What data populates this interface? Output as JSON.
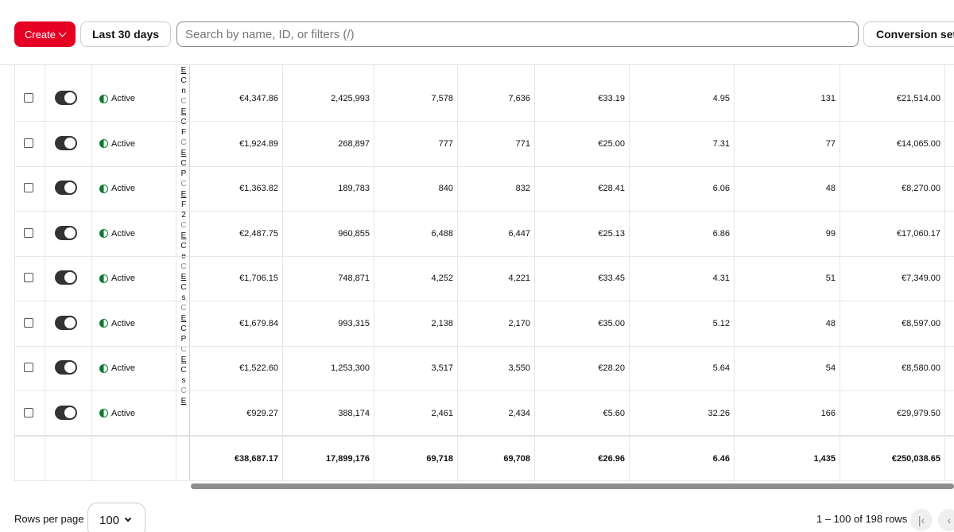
{
  "toolbar": {
    "create_label": "Create",
    "date_label": "Last 30 days",
    "search_placeholder": "Search by name, ID, or filters (/)",
    "conversion_label": "Conversion set"
  },
  "colors": {
    "accent": "#e60023",
    "active_status": "#0a7a2f",
    "toggle_on": "#333333"
  },
  "rows": [
    {
      "status": "Active",
      "spend": "€4,347.86",
      "impressions": "2,425,993",
      "c1": "7,578",
      "c2": "7,636",
      "cpa": "€33.19",
      "roas": "4.95",
      "conversions": "131",
      "value": "€21,514.00",
      "toggle": true,
      "checked": false
    },
    {
      "status": "Active",
      "spend": "€1,924.89",
      "impressions": "268,897",
      "c1": "777",
      "c2": "771",
      "cpa": "€25.00",
      "roas": "7.31",
      "conversions": "77",
      "value": "€14,065.00",
      "toggle": true,
      "checked": false
    },
    {
      "status": "Active",
      "spend": "€1,363.82",
      "impressions": "189,783",
      "c1": "840",
      "c2": "832",
      "cpa": "€28.41",
      "roas": "6.06",
      "conversions": "48",
      "value": "€8,270.00",
      "toggle": true,
      "checked": false
    },
    {
      "status": "Active",
      "spend": "€2,487.75",
      "impressions": "960,855",
      "c1": "6,488",
      "c2": "6,447",
      "cpa": "€25.13",
      "roas": "6.86",
      "conversions": "99",
      "value": "€17,060.17",
      "toggle": true,
      "checked": false
    },
    {
      "status": "Active",
      "spend": "€1,706.15",
      "impressions": "748,871",
      "c1": "4,252",
      "c2": "4,221",
      "cpa": "€33.45",
      "roas": "4.31",
      "conversions": "51",
      "value": "€7,349.00",
      "toggle": true,
      "checked": false
    },
    {
      "status": "Active",
      "spend": "€1,679.84",
      "impressions": "993,315",
      "c1": "2,138",
      "c2": "2,170",
      "cpa": "€35.00",
      "roas": "5.12",
      "conversions": "48",
      "value": "€8,597.00",
      "toggle": true,
      "checked": false
    },
    {
      "status": "Active",
      "spend": "€1,522.60",
      "impressions": "1,253,300",
      "c1": "3,517",
      "c2": "3,550",
      "cpa": "€28.20",
      "roas": "5.64",
      "conversions": "54",
      "value": "€8,580.00",
      "toggle": true,
      "checked": false
    },
    {
      "status": "Active",
      "spend": "€929.27",
      "impressions": "388,174",
      "c1": "2,461",
      "c2": "2,434",
      "cpa": "€5.60",
      "roas": "32.26",
      "conversions": "166",
      "value": "€29,979.50",
      "toggle": true,
      "checked": false
    }
  ],
  "name_column_glyphs": [
    [
      "E",
      "C",
      "n",
      "C"
    ],
    [
      "E",
      "C",
      "F",
      "C"
    ],
    [
      "E",
      "C",
      "P",
      "C"
    ],
    [
      "E",
      "F",
      "2",
      "C"
    ],
    [
      "E",
      "C",
      "e",
      "C"
    ],
    [
      "E",
      "C",
      "s",
      "C"
    ],
    [
      "E",
      "C",
      "P",
      "C"
    ],
    [
      "E",
      "C",
      "s",
      "C"
    ],
    [
      "E"
    ]
  ],
  "totals": {
    "spend": "€38,687.17",
    "impressions": "17,899,176",
    "c1": "69,718",
    "c2": "69,708",
    "cpa": "€26.96",
    "roas": "6.46",
    "conversions": "1,435",
    "value": "€250,038.65"
  },
  "footer": {
    "rows_per_page_label": "Rows per page",
    "rows_per_page_value": "100",
    "range_text": "1 – 100 of 198 rows",
    "first_page_icon": "first-page-icon",
    "prev_page_icon": "prev-page-icon"
  }
}
